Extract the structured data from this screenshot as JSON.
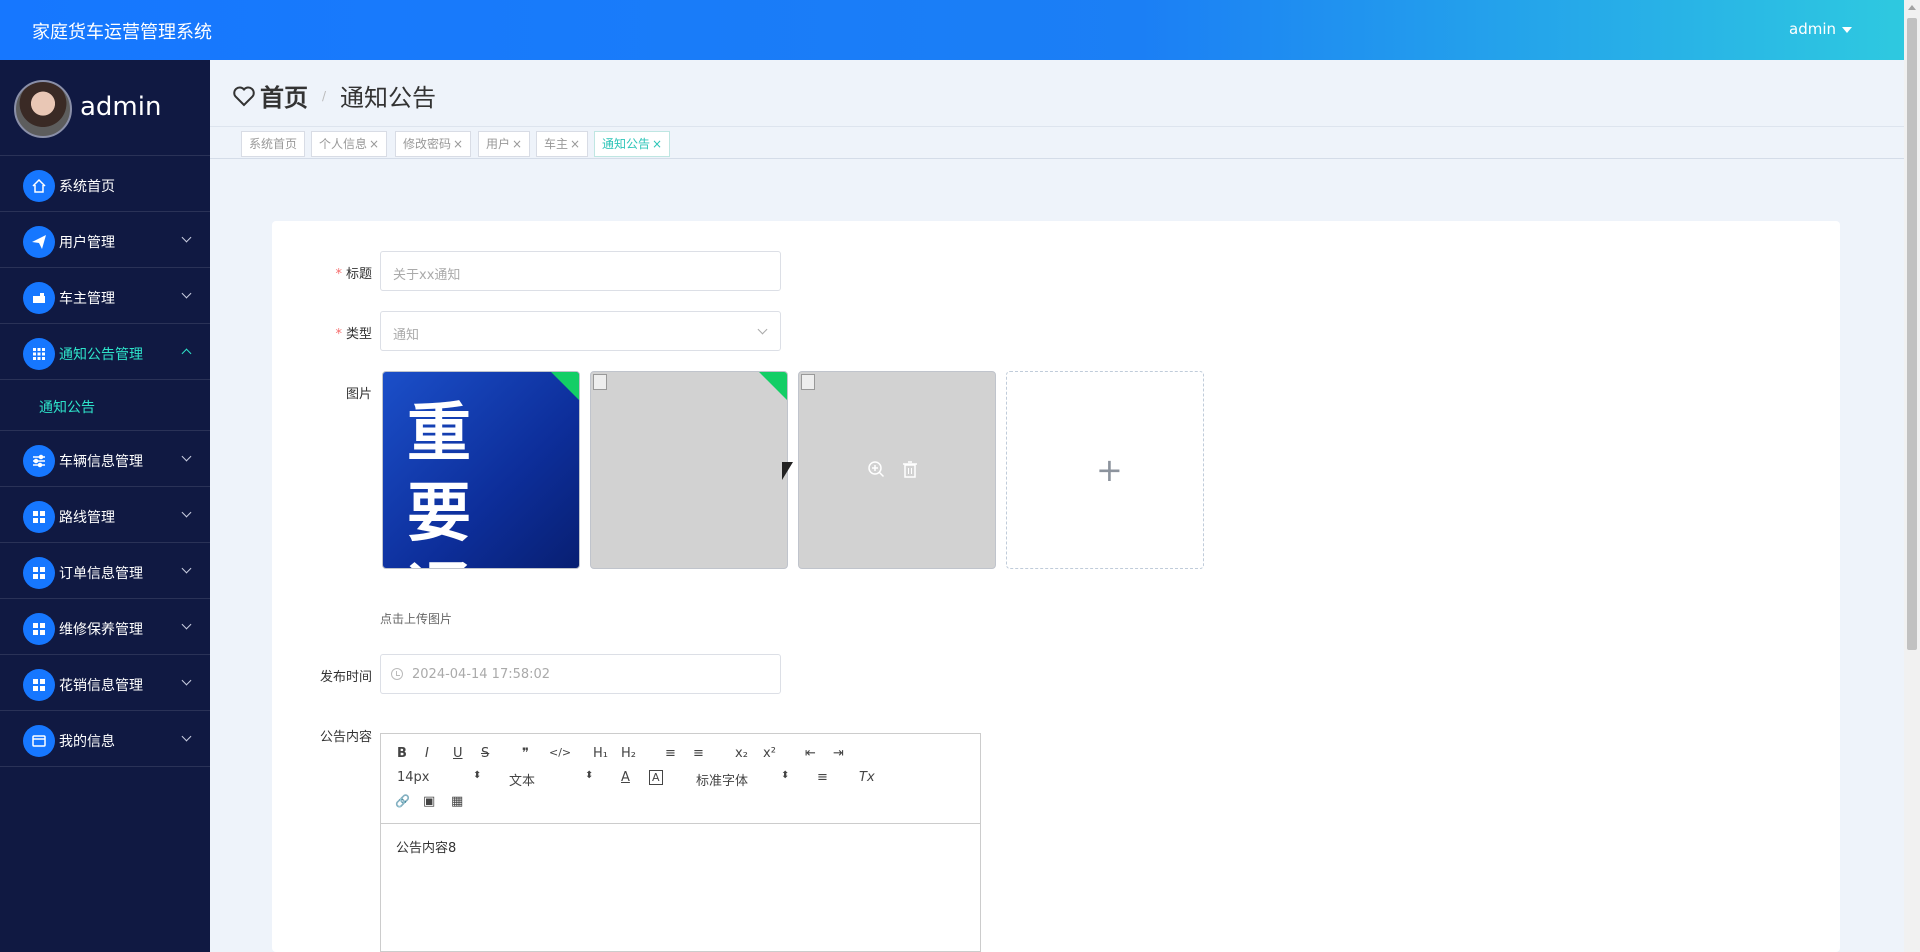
{
  "header": {
    "app_title": "家庭货车运营管理系统",
    "user_menu": "admin"
  },
  "sidebar": {
    "profile_name": "admin",
    "items": [
      {
        "label": "系统首页",
        "icon": "home-icon"
      },
      {
        "label": "用户管理",
        "icon": "paper-plane-icon"
      },
      {
        "label": "车主管理",
        "icon": "car-owner-icon"
      },
      {
        "label": "通知公告管理",
        "icon": "grid-icon",
        "expanded": true
      },
      {
        "label": "车辆信息管理",
        "icon": "sliders-icon"
      },
      {
        "label": "路线管理",
        "icon": "apps-icon"
      },
      {
        "label": "订单信息管理",
        "icon": "apps-icon"
      },
      {
        "label": "维修保养管理",
        "icon": "apps-icon"
      },
      {
        "label": "花销信息管理",
        "icon": "apps-icon"
      },
      {
        "label": "我的信息",
        "icon": "wallet-icon"
      }
    ],
    "sub_item": "通知公告"
  },
  "breadcrumb": {
    "home": "首页",
    "separator": "/",
    "current": "通知公告"
  },
  "tabs": [
    {
      "label": "系统首页",
      "closable": false
    },
    {
      "label": "个人信息",
      "closable": true
    },
    {
      "label": "修改密码",
      "closable": true
    },
    {
      "label": "用户",
      "closable": true
    },
    {
      "label": "车主",
      "closable": true
    },
    {
      "label": "通知公告",
      "closable": true,
      "active": true
    }
  ],
  "tab_close": "×",
  "form": {
    "title_label": "标题",
    "title_placeholder": "关于xx通知",
    "type_label": "类型",
    "type_value": "通知",
    "image_label": "图片",
    "image_notice_text_line1": "重 要",
    "image_notice_text_line2": "通 告",
    "upload_hint": "点击上传图片",
    "publish_label": "发布时间",
    "publish_value": "2024-04-14 17:58:02",
    "content_label": "公告内容",
    "content_value": "公告内容8",
    "required_mark": "*"
  },
  "editor": {
    "font_size": "14px",
    "format": "文本",
    "font_family": "标准字体",
    "buttons": {
      "bold": "B",
      "italic": "I",
      "underline": "U",
      "strike": "S",
      "quote": "❞",
      "code": "</>",
      "h1": "H₁",
      "h2": "H₂",
      "ordered": "≡",
      "bullet": "≡",
      "sub": "x₂",
      "sup": "x²",
      "outdent": "⇤",
      "indent": "⇥",
      "color": "A",
      "bg": "A",
      "align": "≡",
      "clean": "Tx",
      "link": "🔗",
      "image": "▣",
      "video": "▦"
    }
  },
  "colors": {
    "primary": "#1677ff",
    "sidebar_bg": "#101942",
    "accent_teal": "#2ee3c9",
    "required": "#f56c6c",
    "upload_success": "#13ce66"
  }
}
